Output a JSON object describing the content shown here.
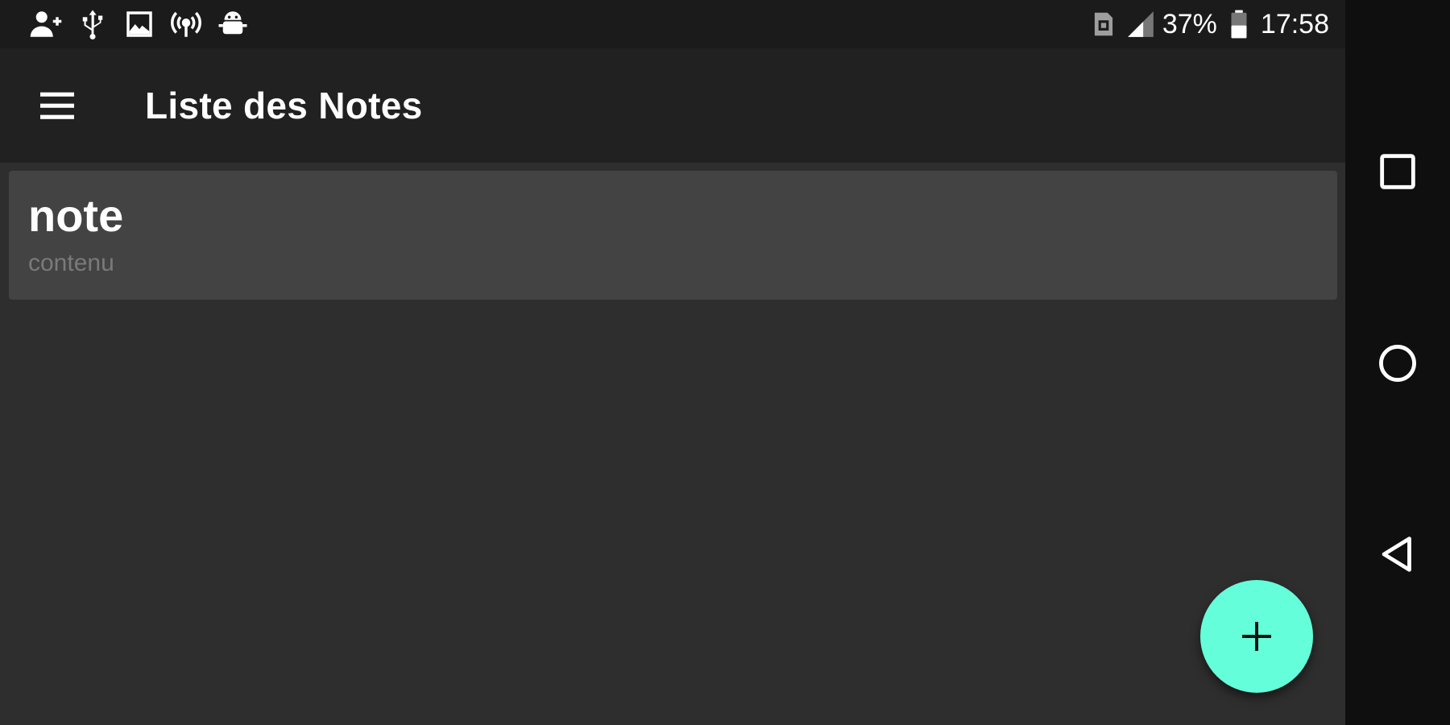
{
  "status_bar": {
    "battery_percent": "37%",
    "time": "17:58",
    "icons_left": [
      "person-add-icon",
      "usb-icon",
      "image-icon",
      "wifi-hotspot-icon",
      "android-debug-icon"
    ],
    "icons_right": [
      "no-sim-icon",
      "signal-icon",
      "battery-icon"
    ]
  },
  "app_bar": {
    "menu_icon": "hamburger-menu-icon",
    "title": "Liste des Notes"
  },
  "notes": [
    {
      "title": "note",
      "content": "contenu"
    }
  ],
  "fab": {
    "icon": "plus-icon",
    "color": "#64ffda"
  },
  "nav_bar": {
    "buttons": [
      "recent-apps-icon",
      "home-icon",
      "back-icon"
    ]
  },
  "colors": {
    "background": "#2e2e2e",
    "app_bar": "#212121",
    "status_bar": "#1b1b1b",
    "card": "#434343",
    "accent": "#64ffda"
  }
}
